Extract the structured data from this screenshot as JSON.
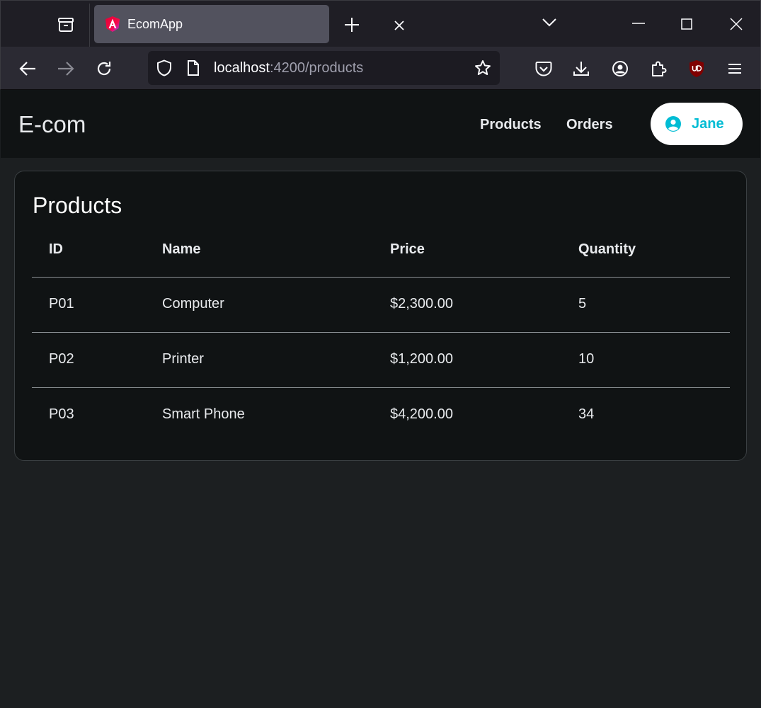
{
  "browser": {
    "tab_title": "EcomApp",
    "url_host": "localhost",
    "url_rest": ":4200/products"
  },
  "app": {
    "brand": "E-com",
    "nav": {
      "products": "Products",
      "orders": "Orders"
    },
    "user": {
      "name": "Jane"
    },
    "accent_color": "#00bcd4"
  },
  "products": {
    "title": "Products",
    "columns": [
      "ID",
      "Name",
      "Price",
      "Quantity"
    ],
    "rows": [
      [
        "P01",
        "Computer",
        "$2,300.00",
        "5"
      ],
      [
        "P02",
        "Printer",
        "$1,200.00",
        "10"
      ],
      [
        "P03",
        "Smart Phone",
        "$4,200.00",
        "34"
      ]
    ]
  }
}
